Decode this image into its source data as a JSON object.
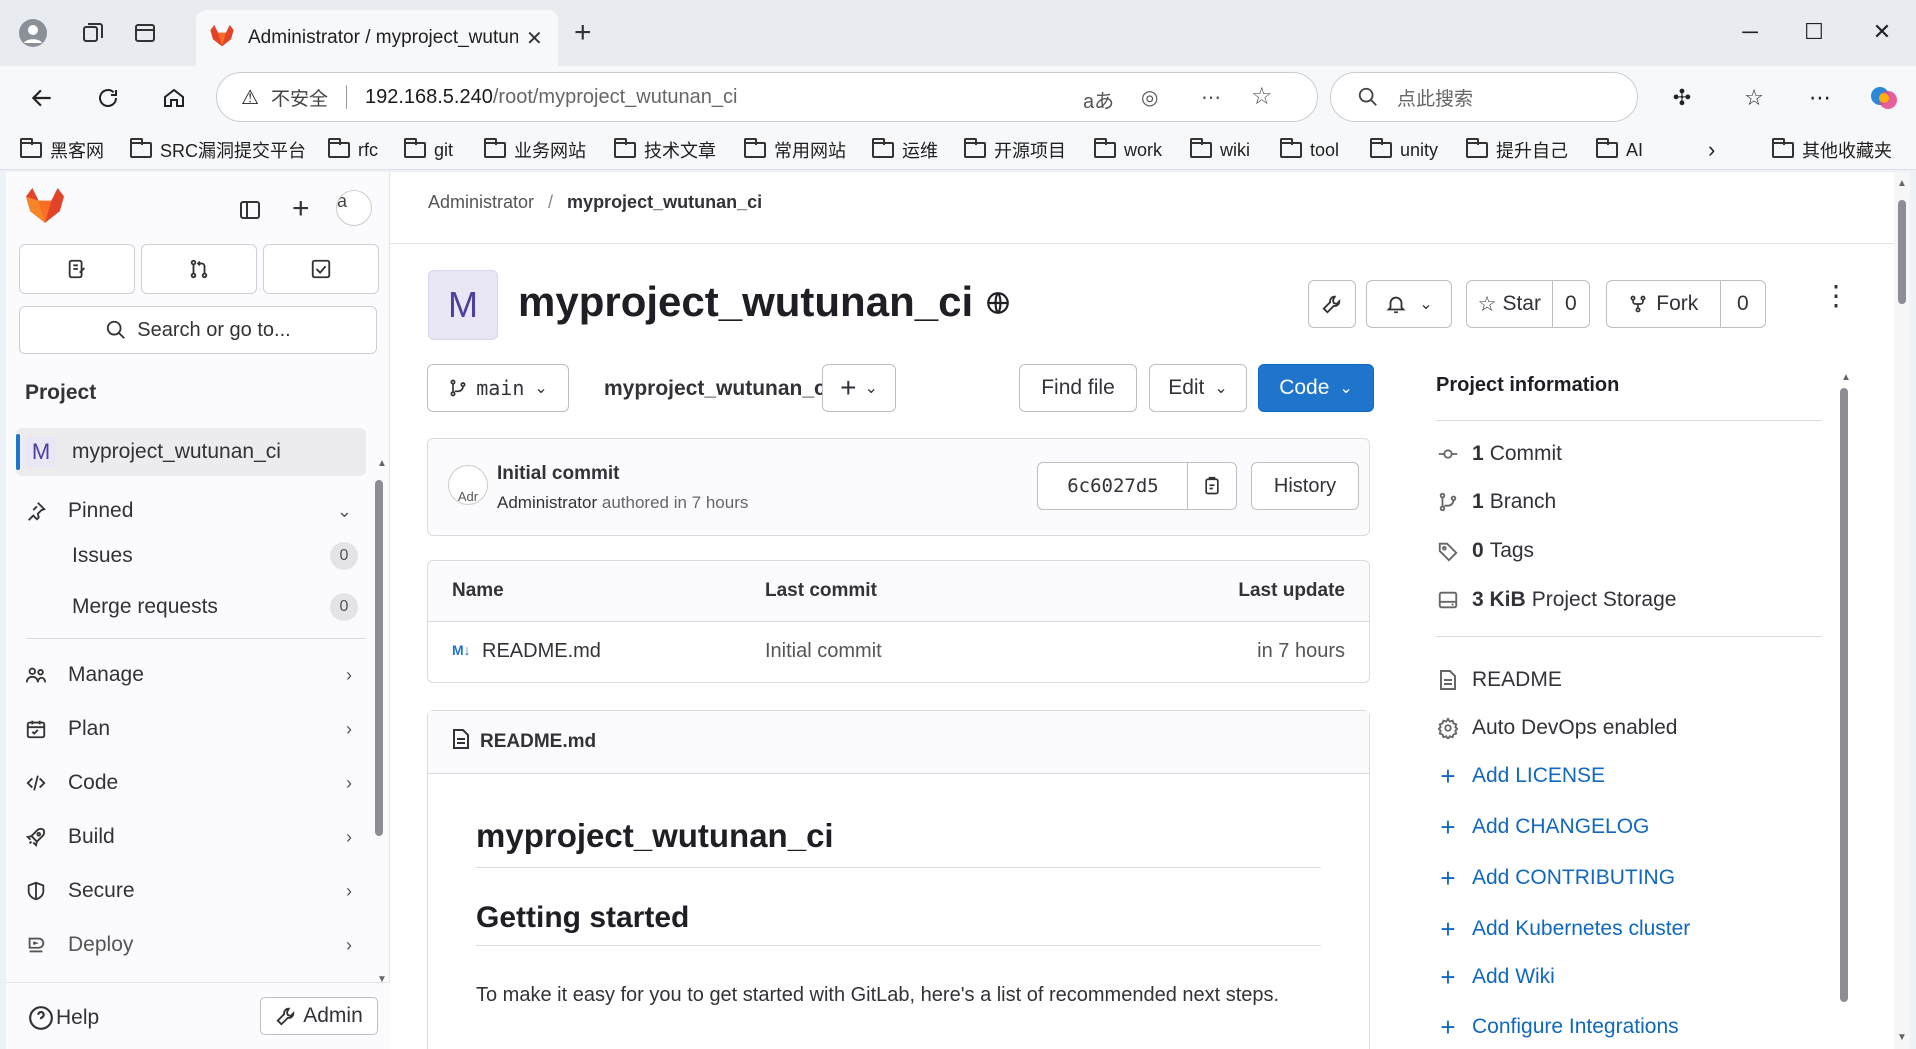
{
  "browser": {
    "tab_title": "Administrator / myproject_wutunan_ci · GitLab",
    "security_label": "不安全",
    "url_host": "192.168.5.240",
    "url_path": "/root/myproject_wutunan_ci",
    "search_placeholder": "点此搜索",
    "bookmarks": [
      "黑客网",
      "SRC漏洞提交平台",
      "rfc",
      "git",
      "业务网站",
      "技术文章",
      "常用网站",
      "运维",
      "开源项目",
      "work",
      "wiki",
      "tool",
      "unity",
      "提升自己",
      "AI"
    ],
    "other_bookmarks": "其他收藏夹"
  },
  "sidebar": {
    "search_label": "Search or go to...",
    "section_title": "Project",
    "current_project": "myproject_wutunan_ci",
    "current_project_letter": "M",
    "pinned": "Pinned",
    "issues": {
      "label": "Issues",
      "count": "0"
    },
    "merge_requests": {
      "label": "Merge requests",
      "count": "0"
    },
    "items": [
      "Manage",
      "Plan",
      "Code",
      "Build",
      "Secure",
      "Deploy"
    ],
    "help": "Help",
    "admin": "Admin"
  },
  "breadcrumb": {
    "root": "Administrator",
    "current": "myproject_wutunan_ci"
  },
  "project": {
    "letter": "M",
    "name": "myproject_wutunan_ci",
    "star_label": "Star",
    "star_count": "0",
    "fork_label": "Fork",
    "fork_count": "0"
  },
  "repo": {
    "branch": "main",
    "path": "myproject_wutunan_ci",
    "path_sep": "/",
    "find_file": "Find file",
    "edit": "Edit",
    "code": "Code"
  },
  "commit": {
    "avatar_alt": "Adr",
    "title": "Initial commit",
    "author": "Administrator",
    "authored": "authored in 7 hours",
    "sha": "6c6027d5",
    "history": "History"
  },
  "files": {
    "headers": [
      "Name",
      "Last commit",
      "Last update"
    ],
    "rows": [
      {
        "name": "README.md",
        "commit": "Initial commit",
        "updated": "in 7 hours"
      }
    ]
  },
  "readme": {
    "file": "README.md",
    "h1": "myproject_wutunan_ci",
    "h2": "Getting started",
    "p": "To make it easy for you to get started with GitLab, here's a list of recommended next steps."
  },
  "project_info": {
    "title": "Project information",
    "commits": {
      "num": "1",
      "label": "Commit"
    },
    "branches": {
      "num": "1",
      "label": "Branch"
    },
    "tags": {
      "num": "0",
      "label": "Tags"
    },
    "storage": {
      "num": "3 KiB",
      "label": "Project Storage"
    },
    "readme": "README",
    "autodevops": "Auto DevOps enabled",
    "links": [
      "Add LICENSE",
      "Add CHANGELOG",
      "Add CONTRIBUTING",
      "Add Kubernetes cluster",
      "Add Wiki",
      "Configure Integrations"
    ]
  },
  "colors": {
    "accent": "#1f75cb",
    "link": "#1068bf",
    "gitlab_orange": "#e24329"
  }
}
